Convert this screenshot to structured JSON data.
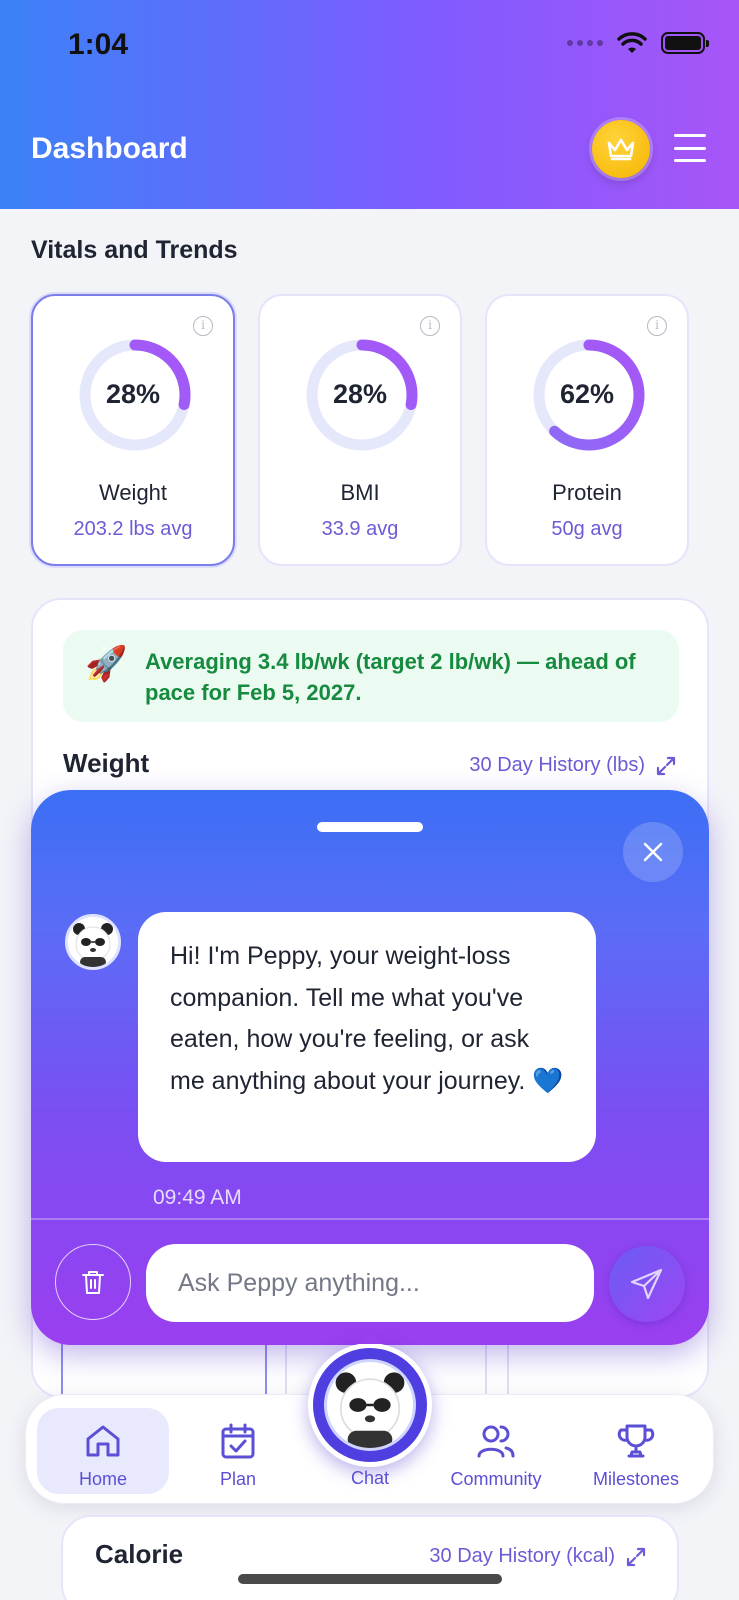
{
  "status_bar": {
    "time": "1:04"
  },
  "header": {
    "title": "Dashboard"
  },
  "vitals": {
    "title": "Vitals and Trends",
    "cards": [
      {
        "percent_label": "28%",
        "progress": 0.28,
        "name": "Weight",
        "avg": "203.2 lbs avg",
        "selected": true
      },
      {
        "percent_label": "28%",
        "progress": 0.28,
        "name": "BMI",
        "avg": "33.9 avg",
        "selected": false
      },
      {
        "percent_label": "62%",
        "progress": 0.62,
        "name": "Protein",
        "avg": "50g avg",
        "selected": false
      }
    ]
  },
  "weight_card": {
    "pace_text": "Averaging 3.4 lb/wk (target 2 lb/wk) — ahead of pace for Feb 5, 2027.",
    "title": "Weight",
    "history_label": "30 Day History (lbs)"
  },
  "chat": {
    "message": "Hi! I'm Peppy, your weight-loss companion. Tell me what you've eaten, how you're feeling, or ask me anything about your journey. 💙",
    "time": "09:49 AM",
    "input_placeholder": "Ask Peppy anything..."
  },
  "nav": {
    "items": [
      {
        "label": "Home",
        "icon": "home-icon",
        "active": true
      },
      {
        "label": "Plan",
        "icon": "calendar-check-icon",
        "active": false
      },
      {
        "label": "Chat",
        "icon": "panda-avatar-icon",
        "active": false
      },
      {
        "label": "Community",
        "icon": "users-icon",
        "active": false
      },
      {
        "label": "Milestones",
        "icon": "trophy-icon",
        "active": false
      }
    ]
  },
  "calorie_card": {
    "title": "Calorie",
    "history_label": "30 Day History (kcal)"
  },
  "colors": {
    "accent": "#6b5bd6",
    "header_start": "#3b82f6",
    "header_end": "#a855f7",
    "success_text": "#168a3f",
    "crown": "#f5b400"
  }
}
